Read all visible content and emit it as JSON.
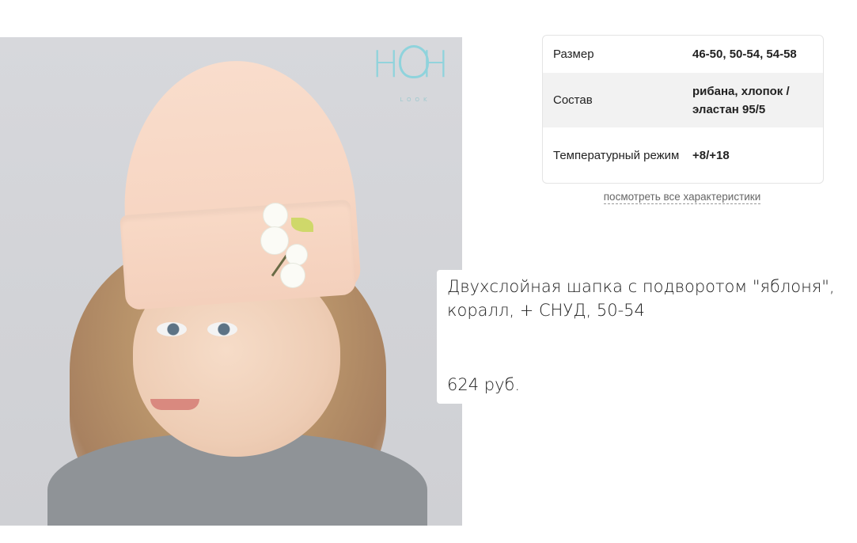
{
  "product": {
    "image_alt": "child wearing coral beanie with apple blossom print",
    "brand_logo": {
      "letters": "HH",
      "sub": "LOOK"
    },
    "title": "Двухслойная шапка с подворотом \"яблоня\", коралл, + СНУД, 50-54",
    "price": "624 руб."
  },
  "specs": {
    "rows": [
      {
        "label": "Размер",
        "value": "46-50, 50-54, 54-58"
      },
      {
        "label": "Состав",
        "value": "рибана, хлопок / эластан 95/5"
      },
      {
        "label": "Температурный режим",
        "value": "+8/+18"
      }
    ],
    "all_link": "посмотреть все характеристики"
  },
  "colors": {
    "logo": "#8fd3dc",
    "hat": "#f7d6c3",
    "row_alt": "#f2f2f2"
  }
}
